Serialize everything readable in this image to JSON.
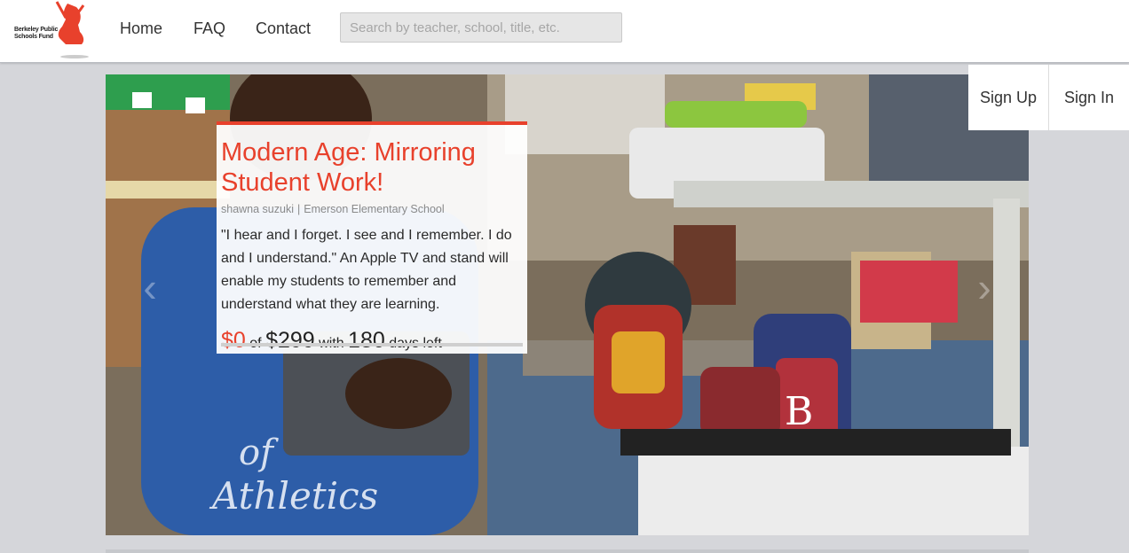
{
  "brand": {
    "line1": "Berkeley Public",
    "line2": "Schools Fund",
    "color": "#e8412c"
  },
  "nav": {
    "home": "Home",
    "faq": "FAQ",
    "contact": "Contact"
  },
  "search": {
    "placeholder": "Search by teacher, school, title, etc."
  },
  "auth": {
    "signup": "Sign Up",
    "signin": "Sign In"
  },
  "project": {
    "title": "Modern Age: Mirroring Student Work!",
    "teacher": "shawna suzuki",
    "separator": "|",
    "school": "Emerson Elementary School",
    "description": "\"I hear and I forget. I see and I remember. I do and I understand.\" An Apple TV and stand will enable my students to remember and understand what they are learning.",
    "raised": "$0",
    "of_text": "of",
    "goal": "$299",
    "with_text": "with",
    "days": "180",
    "days_text": "days left",
    "progress_fraction": 0
  },
  "carousel": {
    "prev_icon": "chevron-left-icon",
    "next_icon": "chevron-right-icon"
  }
}
